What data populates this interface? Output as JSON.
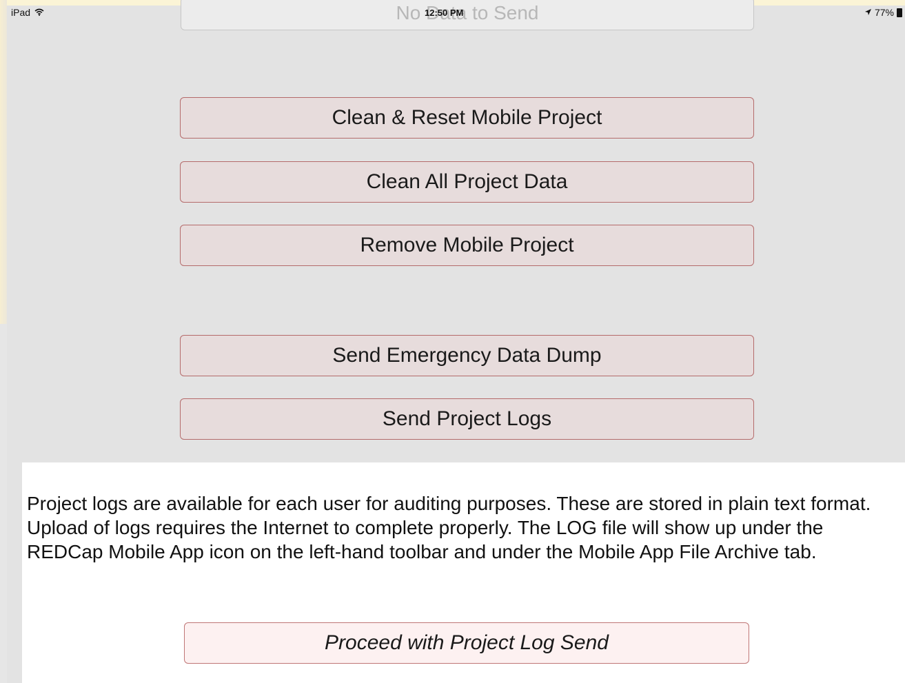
{
  "status_bar": {
    "device": "iPad",
    "time": "12:50 PM",
    "battery": "77%",
    "wifi_icon": "wifi-icon",
    "location_icon": "location-arrow-icon"
  },
  "top_field": {
    "text": "No Data to Send"
  },
  "buttons": {
    "clean_reset": "Clean & Reset Mobile Project",
    "clean_all": "Clean All Project Data",
    "remove_project": "Remove Mobile Project",
    "emergency_dump": "Send Emergency Data Dump",
    "send_logs": "Send Project Logs"
  },
  "info_panel": {
    "text": "Project logs are available for each user for auditing purposes. These are stored in plain text format. Upload of logs requires the Internet to complete properly. The LOG file will show up under the REDCap Mobile App icon on the left-hand toolbar and under the Mobile App File Archive tab.",
    "proceed_label": "Proceed with Project Log Send"
  },
  "colors": {
    "button_fill": "#e7dcdc",
    "button_border": "#b46a6a",
    "background": "#e3e3e3",
    "panel": "#ffffff"
  }
}
